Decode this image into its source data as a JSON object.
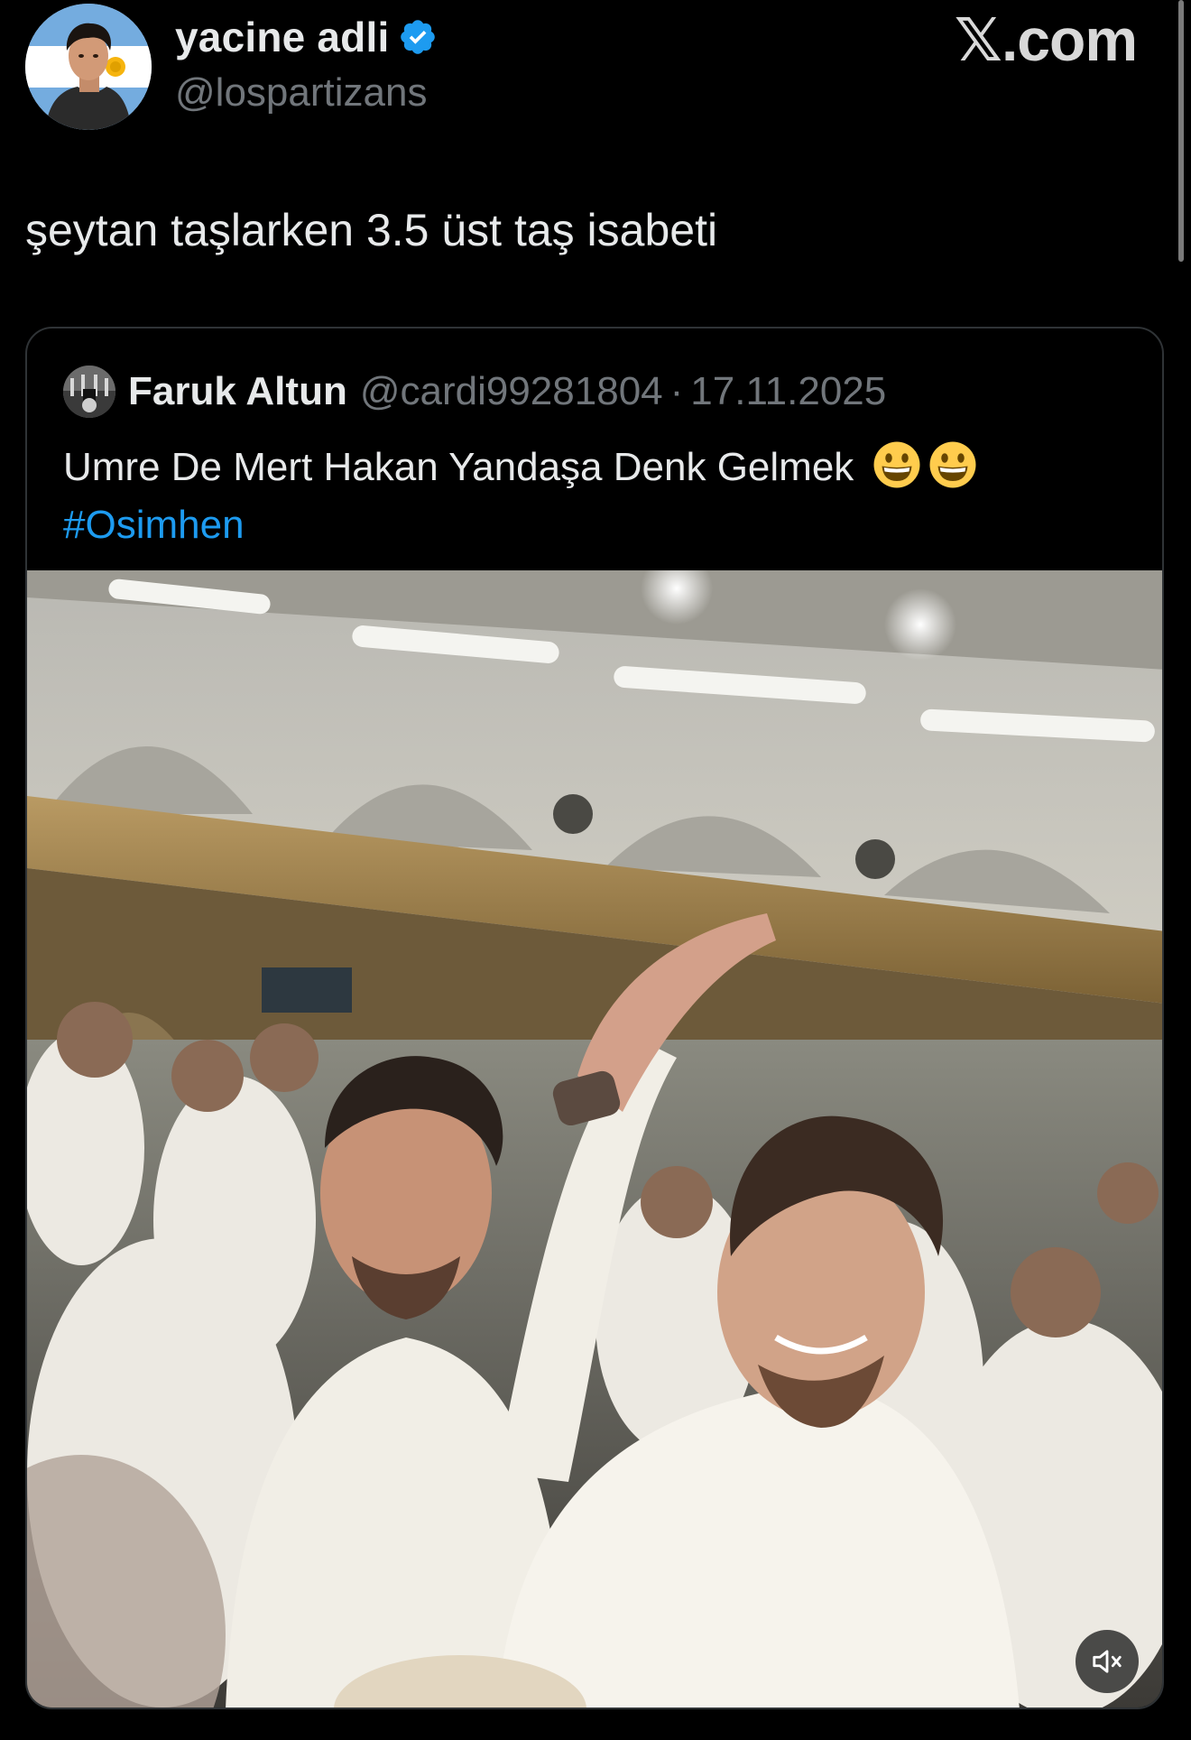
{
  "author": {
    "name": "yacine adli",
    "handle": "@lospartizans",
    "verified_color": "#1d9bf0"
  },
  "brand": "𝕏.com",
  "tweet": {
    "text": "şeytan taşlarken 3.5 üst taş isabeti"
  },
  "quoted": {
    "name": "Faruk Altun",
    "handle": "@cardi99281804",
    "separator": "·",
    "date": "17.11.2025",
    "text": "Umre De Mert Hakan Yandaşa Denk Gelmek",
    "emojis": [
      "grinning-face-icon",
      "grinning-face-icon"
    ],
    "hashtag": "#Osimhen",
    "hashtag_color": "#1d9bf0"
  },
  "media": {
    "type": "video",
    "mute_icon": "speaker-muted-icon"
  },
  "colors": {
    "background": "#000000",
    "primary_text": "#e7e9ea",
    "secondary_text": "#71767b",
    "border": "#2f3336"
  }
}
